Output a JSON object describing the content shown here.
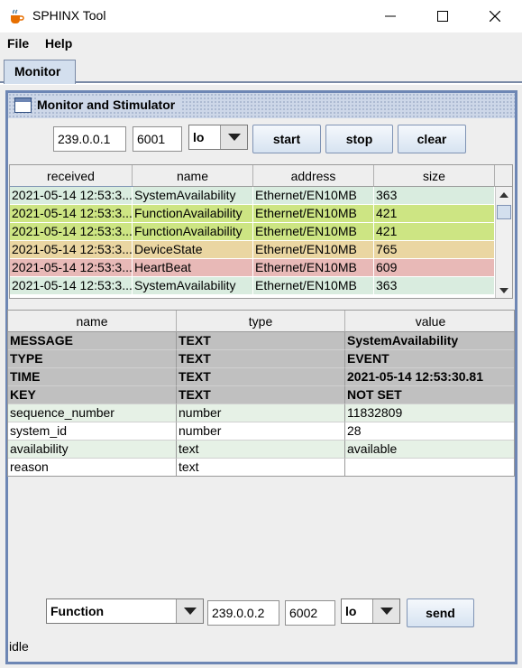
{
  "window": {
    "title": "SPHINX Tool",
    "icon": "java-cup-icon"
  },
  "menu": {
    "items": [
      "File",
      "Help"
    ]
  },
  "tabs": [
    {
      "label": "Monitor"
    }
  ],
  "frame": {
    "title": "Monitor and Stimulator"
  },
  "monitor_controls": {
    "address": "239.0.0.1",
    "port": "6001",
    "interface": "lo",
    "start_label": "start",
    "stop_label": "stop",
    "clear_label": "clear"
  },
  "messages_table": {
    "columns": [
      "received",
      "name",
      "address",
      "size"
    ],
    "rows": [
      {
        "received": "2021-05-14 12:53:3...",
        "name": "SystemAvailability",
        "address": "Ethernet/EN10MB",
        "size": "363",
        "color": "#d9ecdf"
      },
      {
        "received": "2021-05-14 12:53:3...",
        "name": "FunctionAvailability",
        "address": "Ethernet/EN10MB",
        "size": "421",
        "color": "#cde583"
      },
      {
        "received": "2021-05-14 12:53:3...",
        "name": "FunctionAvailability",
        "address": "Ethernet/EN10MB",
        "size": "421",
        "color": "#cde583"
      },
      {
        "received": "2021-05-14 12:53:3...",
        "name": "DeviceState",
        "address": "Ethernet/EN10MB",
        "size": "765",
        "color": "#ead6a2"
      },
      {
        "received": "2021-05-14 12:53:3...",
        "name": "HeartBeat",
        "address": "Ethernet/EN10MB",
        "size": "609",
        "color": "#e8b9b7"
      },
      {
        "received": "2021-05-14 12:53:3...",
        "name": "SystemAvailability",
        "address": "Ethernet/EN10MB",
        "size": "363",
        "color": "#d9ecdf"
      }
    ]
  },
  "details_table": {
    "columns": [
      "name",
      "type",
      "value"
    ],
    "rows": [
      {
        "name": "MESSAGE",
        "type": "TEXT",
        "value": "SystemAvailability",
        "bold": true,
        "color": "#c0c0c0"
      },
      {
        "name": "TYPE",
        "type": "TEXT",
        "value": "EVENT",
        "bold": true,
        "color": "#c0c0c0"
      },
      {
        "name": "TIME",
        "type": "TEXT",
        "value": "2021-05-14 12:53:30.81",
        "bold": true,
        "color": "#c0c0c0"
      },
      {
        "name": "KEY",
        "type": "TEXT",
        "value": "NOT SET",
        "bold": true,
        "color": "#c0c0c0"
      },
      {
        "name": "sequence_number",
        "type": "number",
        "value": "11832809",
        "bold": false,
        "color": "#e6f1e6"
      },
      {
        "name": "system_id",
        "type": "number",
        "value": "28",
        "bold": false,
        "color": "#ffffff"
      },
      {
        "name": "availability",
        "type": "text",
        "value": "available",
        "bold": false,
        "color": "#e6f1e6"
      },
      {
        "name": "reason",
        "type": "text",
        "value": "",
        "bold": false,
        "color": "#ffffff"
      }
    ]
  },
  "send_controls": {
    "message_type": "Function",
    "address": "239.0.0.2",
    "port": "6002",
    "interface": "lo",
    "send_label": "send"
  },
  "status": "idle"
}
